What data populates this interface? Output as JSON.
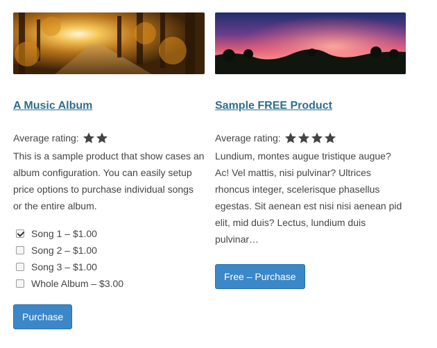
{
  "products": [
    {
      "title": "A Music Album",
      "image": "autumn-forest-path",
      "rating_label": "Average rating:",
      "rating_stars": 2,
      "description": "This is a sample product that show cases an album configuration. You can easily setup price options to purchase individual songs or the entire album.",
      "options": [
        {
          "label": "Song 1 – $1.00",
          "checked": true
        },
        {
          "label": "Song 2 – $1.00",
          "checked": false
        },
        {
          "label": "Song 3 – $1.00",
          "checked": false
        },
        {
          "label": "Whole Album – $3.00",
          "checked": false
        }
      ],
      "button_label": "Purchase"
    },
    {
      "title": "Sample FREE Product",
      "image": "purple-sunset-sky",
      "rating_label": "Average rating:",
      "rating_stars": 4,
      "description": "Lundium, montes augue tristique augue? Ac! Vel mattis, nisi pulvinar? Ultrices rhoncus integer, scelerisque phasellus egestas. Sit aenean est nisi nisi aenean pid elit, mid duis? Lectus, lundium duis pulvinar…",
      "button_label": "Free – Purchase"
    }
  ],
  "colors": {
    "link": "#2c6e8f",
    "button_bg": "#3b87c8",
    "text": "#444444"
  }
}
